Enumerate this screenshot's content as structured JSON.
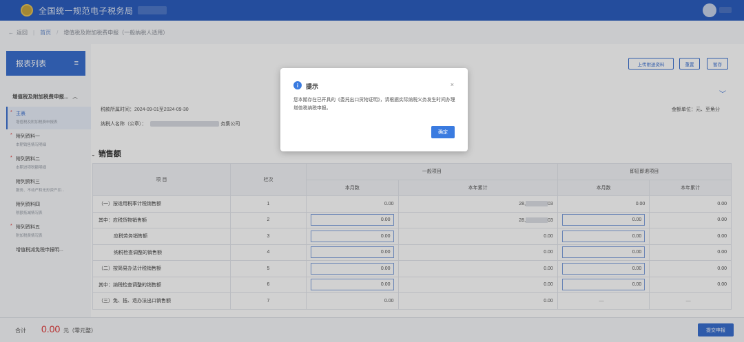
{
  "header": {
    "app_title": "全国统一规范电子税务局"
  },
  "breadcrumb": {
    "back": "返回",
    "home": "首页",
    "current": "增值税及附加税费申报（一般纳税人适用）"
  },
  "sidebar": {
    "title": "报表列表",
    "group": "增值税及附加税费申报...",
    "items": [
      {
        "title": "主表",
        "sub": "增值税及附加税费申报表",
        "required": "*"
      },
      {
        "title": "附列资料一",
        "sub": "本期销售情况明细",
        "required": "*"
      },
      {
        "title": "附列资料二",
        "sub": "本期进项税额明细",
        "required": "*"
      },
      {
        "title": "附列资料三",
        "sub": "服务、不动产和无形资产扣...",
        "required": ""
      },
      {
        "title": "附列资料四",
        "sub": "税额抵减情况表",
        "required": ""
      },
      {
        "title": "附列资料五",
        "sub": "附加税费情况表",
        "required": "*"
      },
      {
        "title": "增值税减免税申报明...",
        "sub": "",
        "required": ""
      }
    ]
  },
  "toolbar": {
    "upload_label": "上传附送资料",
    "reset_label": "重置",
    "save_label": "暂存"
  },
  "info": {
    "period_label": "税款所属时间：",
    "period_value": "2024-09-01至2024-09-30",
    "taxpayer_label": "纳税人名称（公章）：",
    "taxpayer_suffix": "务集公司",
    "unit_label": "金额单位：元、至角分"
  },
  "section": {
    "title": "销售额"
  },
  "table": {
    "headers": {
      "item": "项 目",
      "line": "栏次",
      "general": "一般项目",
      "immediate": "即征即退项目",
      "current_month": "本月数",
      "ytd": "本年累计"
    },
    "rows": [
      {
        "item": "（一）按适用税率计税销售额",
        "line": "1",
        "g_month": "0.00",
        "g_ytd_prefix": "28,",
        "g_ytd_suffix": "03",
        "i_month": "0.00",
        "i_ytd": "0.00"
      },
      {
        "item": "其中：应税货物销售额",
        "line": "2",
        "g_month": "0.00",
        "g_ytd_prefix": "28,",
        "g_ytd_suffix": "03",
        "i_month": "0.00",
        "i_ytd": "0.00"
      },
      {
        "item": "应税劳务销售额",
        "line": "3",
        "g_month": "0.00",
        "g_ytd": "0.00",
        "i_month": "0.00",
        "i_ytd": "0.00"
      },
      {
        "item": "纳税检查调整的销售额",
        "line": "4",
        "g_month": "0.00",
        "g_ytd": "0.00",
        "i_month": "0.00",
        "i_ytd": "0.00"
      },
      {
        "item": "（二）按简易办法计税销售额",
        "line": "5",
        "g_month": "0.00",
        "g_ytd": "0.00",
        "i_month": "0.00",
        "i_ytd": "0.00"
      },
      {
        "item": "其中：纳税检查调整的销售额",
        "line": "6",
        "g_month": "0.00",
        "g_ytd": "0.00",
        "i_month": "0.00",
        "i_ytd": "0.00"
      },
      {
        "item": "（三）免、抵、退办法出口销售额",
        "line": "7",
        "g_month": "0.00",
        "g_ytd": "0.00",
        "i_month": "—",
        "i_ytd": "—"
      }
    ]
  },
  "footer": {
    "total_label": "合计",
    "total_value": "0.00",
    "total_unit": "元（零元整）",
    "submit_label": "提交申报"
  },
  "dialog": {
    "icon": "i",
    "title": "提示",
    "close": "×",
    "message": "您本期存在已开具的《委托出口货物证明》，请根据实际纳税义务发生时间办理增值税纳税申报。",
    "ok_label": "确定"
  },
  "colors": {
    "primary": "#2c5fc0",
    "accent": "#3a7be0",
    "danger": "#e03a3a"
  }
}
